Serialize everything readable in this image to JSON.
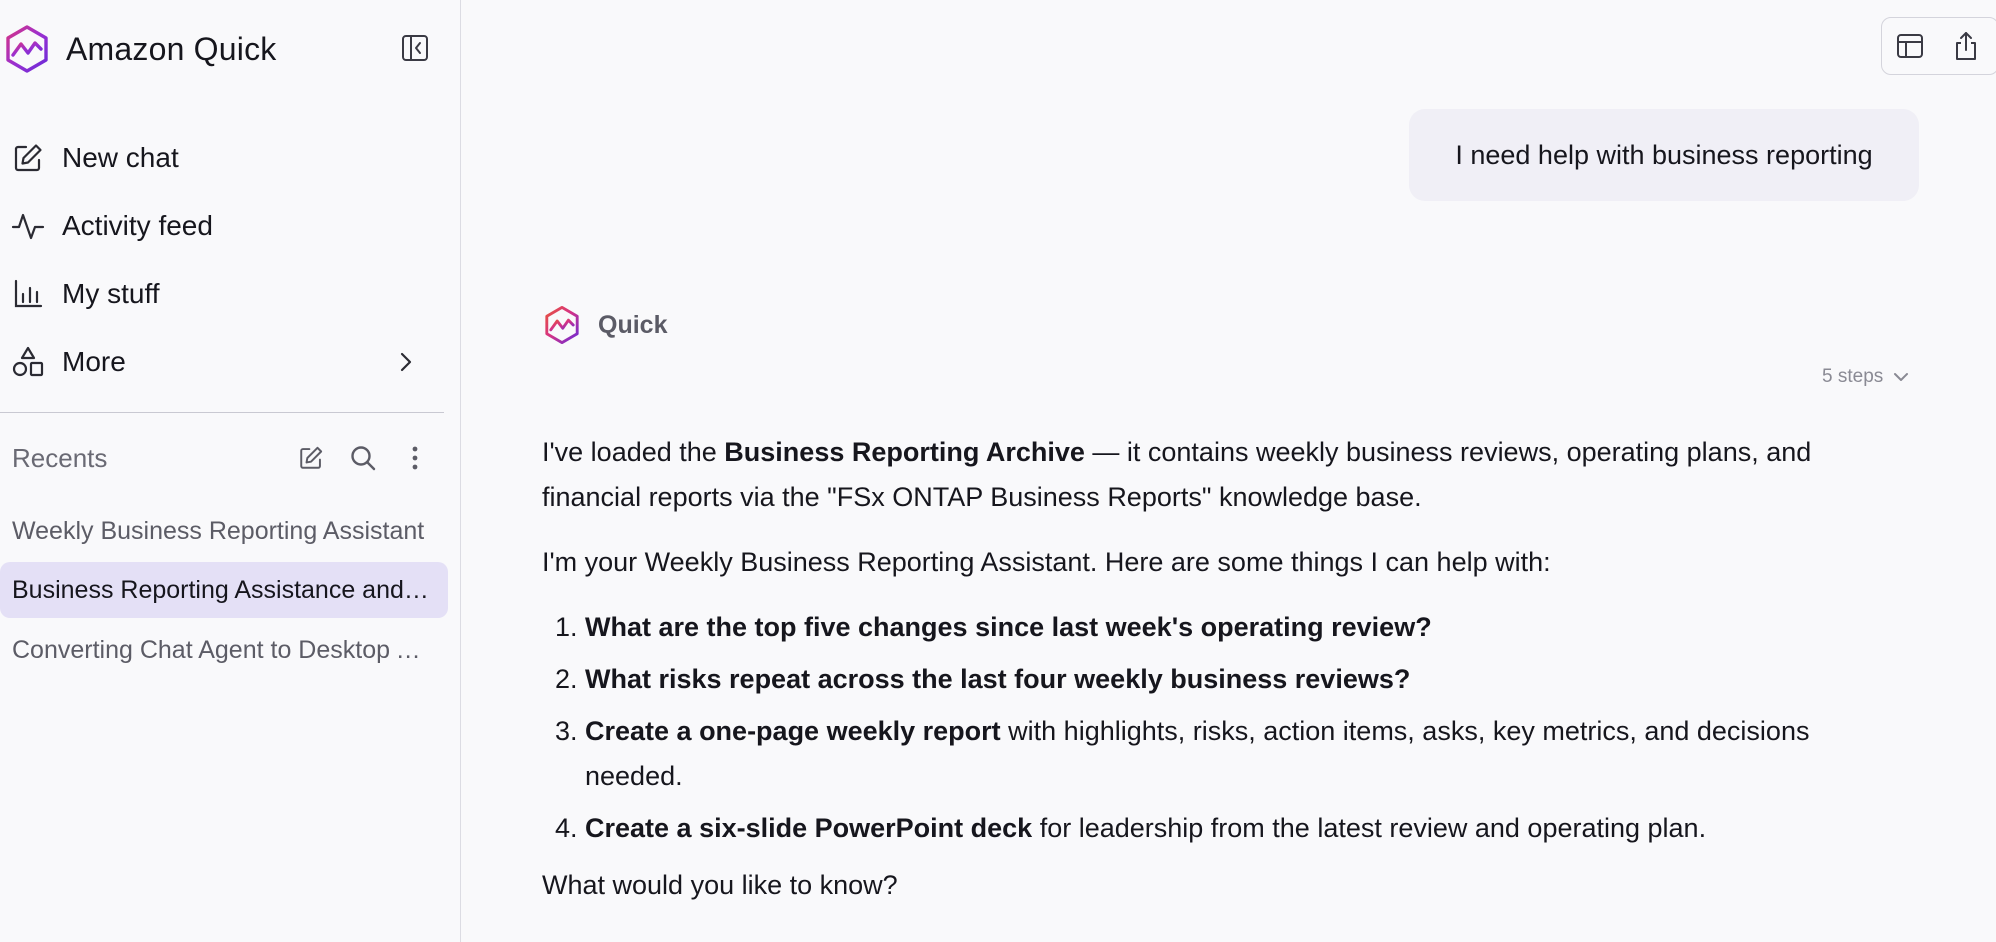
{
  "app": {
    "name": "Amazon Quick"
  },
  "nav": [
    {
      "label": "New chat",
      "icon": "compose-icon"
    },
    {
      "label": "Activity feed",
      "icon": "activity-icon"
    },
    {
      "label": "My stuff",
      "icon": "bar-chart-icon"
    },
    {
      "label": "More",
      "icon": "shapes-icon"
    }
  ],
  "recents": {
    "title": "Recents",
    "items": [
      {
        "label": "Weekly Business Reporting Assistant"
      },
      {
        "label": "Business Reporting Assistance and Templates",
        "active": true
      },
      {
        "label": "Converting Chat Agent to Desktop App"
      }
    ]
  },
  "chat": {
    "user_message": "I need help with business reporting",
    "agent_name": "Quick",
    "steps_label": "5 steps",
    "p1_a": "I've loaded the ",
    "p1_b": "Business Reporting Archive",
    "p1_c": " — it contains weekly business reviews, operating plans, and financial reports via the \"FSx ONTAP Business Reports\" knowledge base.",
    "p2": "I'm your Weekly Business Reporting Assistant. Here are some things I can help with:",
    "list": [
      {
        "bold": "What are the top five changes since last week's operating review?",
        "rest": ""
      },
      {
        "bold": "What risks repeat across the last four weekly business reviews?",
        "rest": ""
      },
      {
        "bold": "Create a one-page weekly report",
        "rest": " with highlights, risks, action items, asks, key metrics, and decisions needed."
      },
      {
        "bold": "Create a six-slide PowerPoint deck",
        "rest": " for leadership from the latest review and operating plan."
      }
    ],
    "closing": "What would you like to know?"
  },
  "colors": {
    "accent_purple": "#8b2fc9",
    "accent_pink": "#d63384",
    "active_bg": "#e4e0f6"
  }
}
